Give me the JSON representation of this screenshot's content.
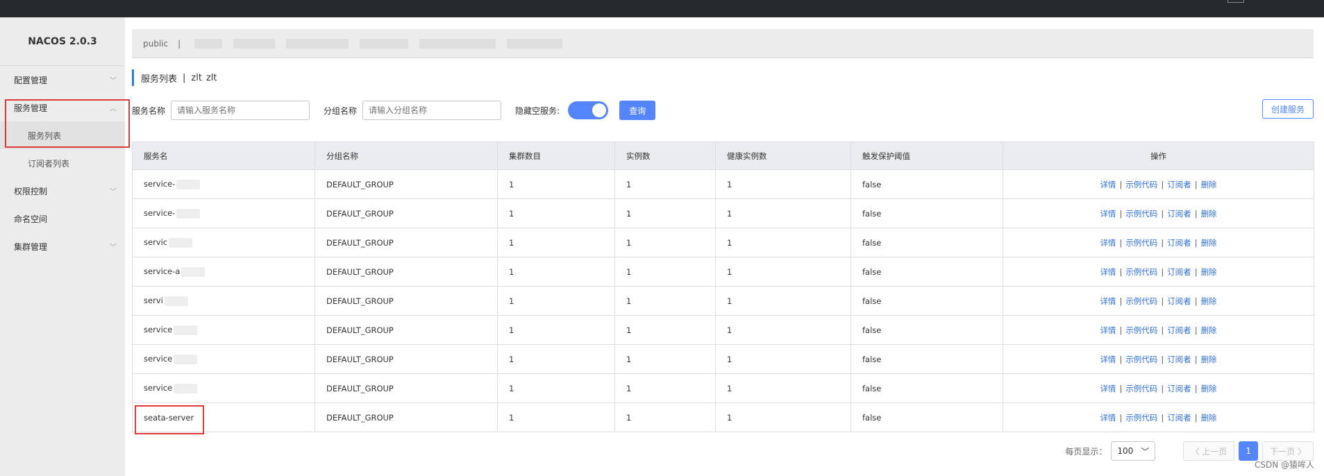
{
  "brand": "NACOS 2.0.3",
  "sidebar": {
    "items": [
      {
        "label": "配置管理",
        "chevron": "﹀"
      },
      {
        "label": "服务管理",
        "chevron": "︿"
      },
      {
        "label": "服务列表"
      },
      {
        "label": "订阅者列表"
      },
      {
        "label": "权限控制",
        "chevron": "﹀"
      },
      {
        "label": "命名空间"
      },
      {
        "label": "集群管理",
        "chevron": "﹀"
      }
    ]
  },
  "breadcrumb": {
    "namespace": "public",
    "separator": "|"
  },
  "page": {
    "title": "服务列表",
    "separator": "|",
    "ns_name": "zlt",
    "ns_id": "zlt"
  },
  "filters": {
    "service_label": "服务名称",
    "service_placeholder": "请输入服务名称",
    "group_label": "分组名称",
    "group_placeholder": "请输入分组名称",
    "hide_empty_label": "隐藏空服务:",
    "query_label": "查询",
    "create_label": "创建服务"
  },
  "table": {
    "headers": [
      "服务名",
      "分组名称",
      "集群数目",
      "实例数",
      "健康实例数",
      "触发保护阈值",
      "操作"
    ],
    "rows": [
      {
        "name": "service-",
        "group": "DEFAULT_GROUP",
        "clusters": "1",
        "instances": "1",
        "healthy": "1",
        "threshold": "false"
      },
      {
        "name": "service-",
        "group": "DEFAULT_GROUP",
        "clusters": "1",
        "instances": "1",
        "healthy": "1",
        "threshold": "false"
      },
      {
        "name": "servic",
        "group": "DEFAULT_GROUP",
        "clusters": "1",
        "instances": "1",
        "healthy": "1",
        "threshold": "false"
      },
      {
        "name": "service-a",
        "group": "DEFAULT_GROUP",
        "clusters": "1",
        "instances": "1",
        "healthy": "1",
        "threshold": "false"
      },
      {
        "name": "servi",
        "group": "DEFAULT_GROUP",
        "clusters": "1",
        "instances": "1",
        "healthy": "1",
        "threshold": "false"
      },
      {
        "name": "service",
        "group": "DEFAULT_GROUP",
        "clusters": "1",
        "instances": "1",
        "healthy": "1",
        "threshold": "false"
      },
      {
        "name": "service",
        "group": "DEFAULT_GROUP",
        "clusters": "1",
        "instances": "1",
        "healthy": "1",
        "threshold": "false"
      },
      {
        "name": "service",
        "group": "DEFAULT_GROUP",
        "clusters": "1",
        "instances": "1",
        "healthy": "1",
        "threshold": "false"
      },
      {
        "name": "seata-server",
        "group": "DEFAULT_GROUP",
        "clusters": "1",
        "instances": "1",
        "healthy": "1",
        "threshold": "false"
      }
    ],
    "actions": {
      "detail": "详情",
      "sample": "示例代码",
      "subscriber": "订阅者",
      "delete": "删除",
      "separator": "|"
    }
  },
  "pager": {
    "per_page_label": "每页显示：",
    "per_page_value": "100",
    "prev_label": "〈 上一页",
    "current_page": "1",
    "next_label": "下一页 〉"
  },
  "watermark": "CSDN @猿哞人",
  "colors": {
    "accent": "#5584ff",
    "highlight": "#e0393a",
    "sidebar_bg": "#ececec",
    "topbar_bg": "#252a2f"
  }
}
